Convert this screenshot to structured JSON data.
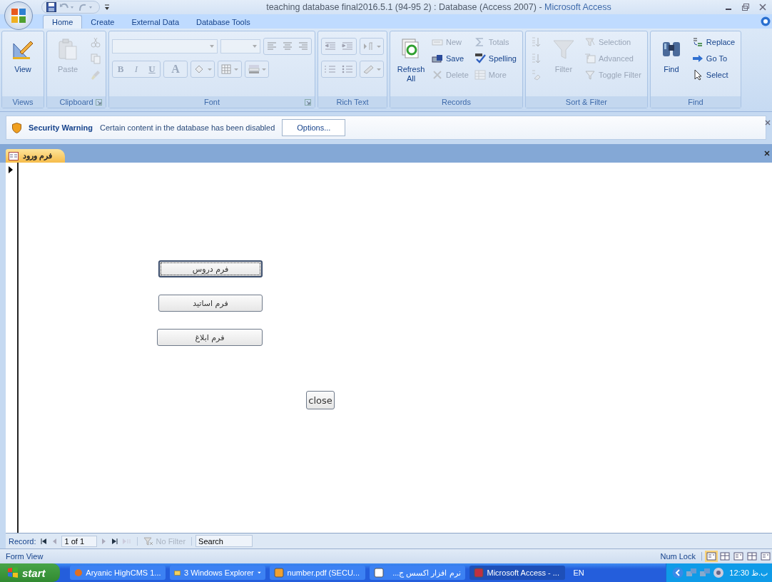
{
  "window": {
    "title": "teaching database final2016.5.1 (94-95 2) : Database (Access 2007)",
    "app_name": "Microsoft Access",
    "separator": "-"
  },
  "tabs": [
    {
      "label": "Home",
      "selected": true
    },
    {
      "label": "Create",
      "selected": false
    },
    {
      "label": "External Data",
      "selected": false
    },
    {
      "label": "Database Tools",
      "selected": false
    }
  ],
  "ribbon": [
    {
      "label": "Views",
      "kind": "tools",
      "launcher": false,
      "items": [
        {
          "kind": "large",
          "label": "View",
          "disabled": false
        }
      ]
    },
    {
      "label": "Clipboard",
      "kind": "tools",
      "launcher": true,
      "items": [
        {
          "kind": "large",
          "label": "Paste",
          "disabled": true
        },
        {
          "kind": "icon",
          "disabled": true
        },
        {
          "kind": "icon",
          "disabled": true
        },
        {
          "kind": "icon",
          "disabled": true
        }
      ]
    },
    {
      "label": "Font",
      "kind": "font",
      "launcher": true,
      "disabled": true,
      "style_buttons": [
        "B",
        "I",
        "U",
        "A"
      ]
    },
    {
      "label": "Rich Text",
      "kind": "richtext",
      "launcher": false,
      "disabled": true
    },
    {
      "label": "Records",
      "kind": "tools",
      "launcher": false,
      "items": [
        {
          "kind": "large",
          "label": "Refresh All",
          "disabled": false
        },
        {
          "kind": "small",
          "label": "New",
          "disabled": true
        },
        {
          "kind": "small",
          "label": "Save",
          "disabled": false
        },
        {
          "kind": "small",
          "label": "Delete",
          "disabled": true
        },
        {
          "kind": "small",
          "label": "Totals",
          "disabled": true
        },
        {
          "kind": "small",
          "label": "Spelling",
          "disabled": false
        },
        {
          "kind": "small",
          "label": "More",
          "disabled": true
        }
      ]
    },
    {
      "label": "Sort & Filter",
      "kind": "tools",
      "launcher": false,
      "items": [
        {
          "kind": "icon",
          "disabled": true
        },
        {
          "kind": "icon",
          "disabled": true
        },
        {
          "kind": "icon",
          "disabled": true
        },
        {
          "kind": "large",
          "label": "Filter",
          "disabled": true
        },
        {
          "kind": "small",
          "label": "Selection",
          "disabled": true
        },
        {
          "kind": "small",
          "label": "Advanced",
          "disabled": true
        },
        {
          "kind": "small",
          "label": "Toggle Filter",
          "disabled": true
        }
      ]
    },
    {
      "label": "Find",
      "kind": "tools",
      "launcher": false,
      "items": [
        {
          "kind": "large",
          "label": "Find",
          "disabled": false
        },
        {
          "kind": "small",
          "label": "Replace",
          "disabled": false
        },
        {
          "kind": "small",
          "label": "Go To",
          "disabled": false
        },
        {
          "kind": "small",
          "label": "Select",
          "disabled": false
        }
      ]
    }
  ],
  "security_bar": {
    "title": "Security Warning",
    "message": "Certain content in the database has been disabled",
    "button": "Options..."
  },
  "document_tab": {
    "label": "فرم ورود",
    "selected": true
  },
  "form": {
    "buttons": [
      {
        "label": "فرم دروس",
        "focused": true
      },
      {
        "label": "فرم اساتید",
        "focused": false
      },
      {
        "label": "فرم ابلاغ",
        "focused": false
      },
      {
        "label": "close",
        "focused": false
      }
    ]
  },
  "record_nav": {
    "label": "Record:",
    "position": "1 of 1",
    "filter": "No Filter",
    "search_placeholder": "Search"
  },
  "status_bar": {
    "view": "Form View",
    "indicator": "Num Lock",
    "views": [
      {
        "selected": true
      },
      {
        "selected": false
      },
      {
        "selected": false
      },
      {
        "selected": false
      },
      {
        "selected": false
      }
    ]
  },
  "taskbar": {
    "start": "start",
    "items": [
      {
        "label": "Aryanic HighCMS 1...",
        "active": false
      },
      {
        "label": "3 Windows Explorer",
        "active": false
      },
      {
        "label": "number.pdf (SECU...",
        "active": false
      },
      {
        "label": "نرم افزار اکسس ج...",
        "active": false
      },
      {
        "label": "Microsoft Access - ...",
        "active": true
      }
    ],
    "language": "EN",
    "clock": "12:30 ب.ظ"
  }
}
